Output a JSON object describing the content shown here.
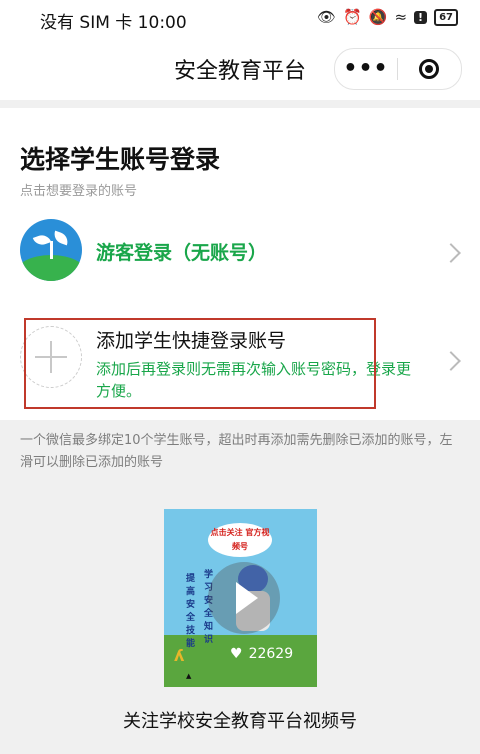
{
  "status_bar": {
    "carrier_time": "没有 SIM 卡 10:00",
    "battery": "67",
    "icons": [
      "eye-icon",
      "alarm-icon",
      "mute-icon",
      "wifi-icon",
      "alert-icon",
      "battery-icon"
    ]
  },
  "nav": {
    "title": "安全教育平台",
    "more_label": "•••",
    "close_icon": "target-icon"
  },
  "page": {
    "heading": "选择学生账号登录",
    "subheading": "点击想要登录的账号"
  },
  "guest": {
    "label": "游客登录（无账号）",
    "icon": "sprout-logo-icon"
  },
  "add_account": {
    "title": "添加学生快捷登录账号",
    "desc": "添加后再登录则无需再次输入账号密码，登录更方便。",
    "icon": "plus-icon"
  },
  "note": "一个微信最多绑定10个学生账号，超出时再添加需先删除已添加的账号，左滑可以删除已添加的账号",
  "video": {
    "bubble_text": "点击关注 官方视频号",
    "vertical_text_1": "学习安全知识",
    "vertical_text_2": "提高安全技能",
    "likes": "22629",
    "caption": "关注学校安全教育平台视频号"
  },
  "colors": {
    "accent_green": "#19a64a",
    "highlight_red": "#c0392b"
  }
}
